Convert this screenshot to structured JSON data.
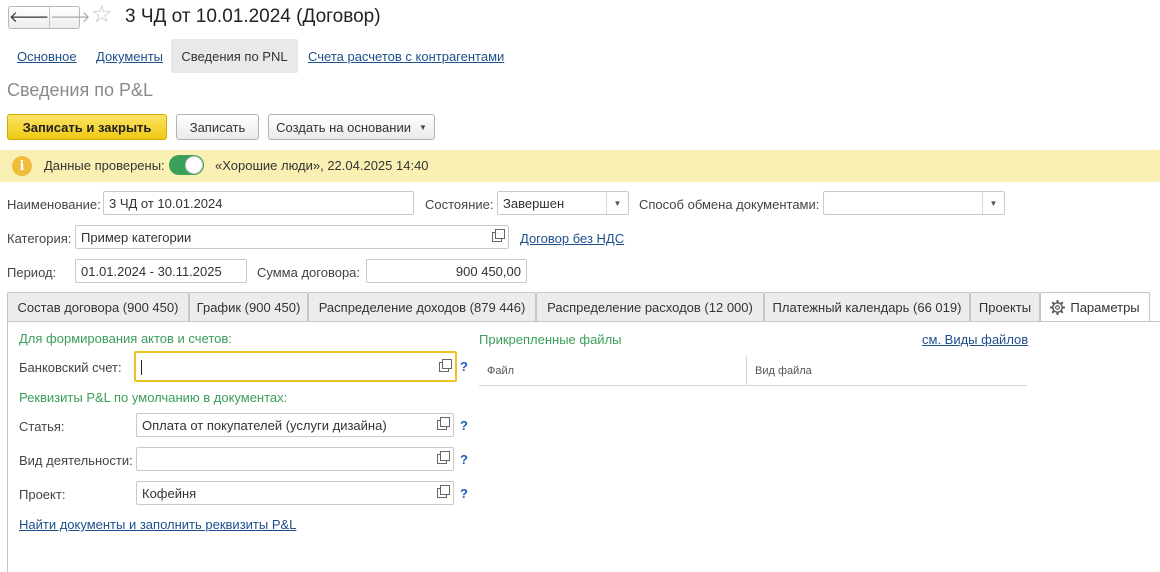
{
  "window": {
    "title": "3 ЧД от 10.01.2024 (Договор)"
  },
  "nav": {
    "back_glyph": "🡐",
    "forward_glyph": "🡒"
  },
  "sections": {
    "main": "Основное",
    "documents": "Документы",
    "pnl": "Сведения по PNL",
    "accounts": "Счета расчетов с контрагентами"
  },
  "page": {
    "title": "Сведения по P&L"
  },
  "toolbar": {
    "save_close": "Записать и закрыть",
    "save": "Записать",
    "create_based": "Создать на основании"
  },
  "info": {
    "label": "Данные проверены:",
    "checked": true,
    "text": "«Хорошие люди», 22.04.2025 14:40"
  },
  "form": {
    "name_label": "Наименование:",
    "name_value": "3 ЧД от 10.01.2024",
    "state_label": "Состояние:",
    "state_value": "Завершен",
    "exchange_label": "Способ обмена документами:",
    "exchange_value": "",
    "category_label": "Категория:",
    "category_value": "Пример категории",
    "vat_link": "Договор без НДС",
    "period_label": "Период:",
    "period_value": "01.01.2024 - 30.11.2025",
    "sum_label": "Сумма договора:",
    "sum_value": "900 450,00"
  },
  "tabs": [
    {
      "label": "Состав договора (900 450)"
    },
    {
      "label": "График (900 450)"
    },
    {
      "label": "Распределение доходов (879 446)"
    },
    {
      "label": "Распределение расходов (12 000)"
    },
    {
      "label": "Платежный календарь (66 019)"
    },
    {
      "label": "Проекты"
    },
    {
      "label": "Параметры"
    }
  ],
  "params": {
    "section_acts": "Для формирования актов и счетов:",
    "bank_label": "Банковский счет:",
    "bank_value": "",
    "section_defaults": "Реквизиты P&L по умолчанию в документах:",
    "article_label": "Статья:",
    "article_value": "Оплата от покупателей (услуги дизайна)",
    "activity_label": "Вид деятельности:",
    "activity_value": "",
    "project_label": "Проект:",
    "project_value": "Кофейня",
    "help": "?",
    "find_link": "Найти документы и заполнить реквизиты P&L"
  },
  "files": {
    "title": "Прикрепленные файлы",
    "types_link": "см. Виды файлов",
    "col_file": "Файл",
    "col_type": "Вид файла"
  },
  "colors": {
    "accent_yellow": "#f0c912",
    "info_bar": "#faf0b4",
    "link_blue": "#1d4f8a",
    "section_green": "#3a9e5a",
    "toggle_green": "#3ba05a"
  }
}
